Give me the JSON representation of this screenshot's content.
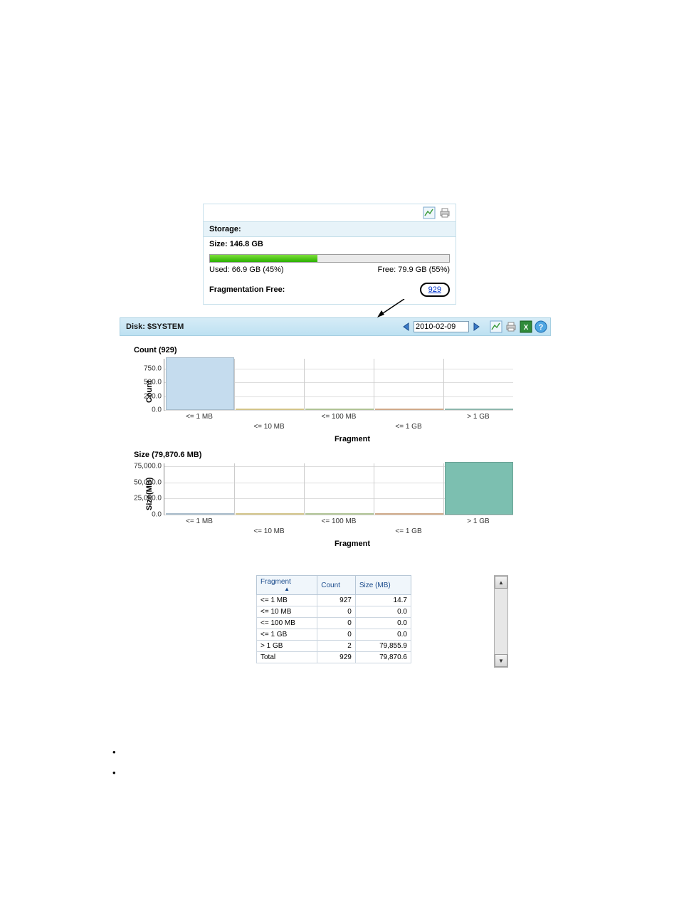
{
  "storage": {
    "header_label": "Storage:",
    "size_label": "Size: 146.8 GB",
    "used_label": "Used: 66.9 GB (45%)",
    "free_label": "Free: 79.9 GB (55%)",
    "used_pct": 45,
    "frag_label": "Fragmentation Free:",
    "frag_value": "929"
  },
  "toolbar": {
    "disk_label": "Disk: $SYSTEM",
    "date": "2010-02-09"
  },
  "chart_data": [
    {
      "type": "bar",
      "title": "Count (929)",
      "ylabel": "Count",
      "xlabel": "Fragment",
      "ylim": [
        0,
        927
      ],
      "yticks": [
        "0.0",
        "250.0",
        "500.0",
        "750.0"
      ],
      "categories": [
        "<= 1 MB",
        "<= 10 MB",
        "<= 100 MB",
        "<= 1 GB",
        "> 1 GB"
      ],
      "values": [
        927,
        0,
        0,
        0,
        2
      ],
      "colors": [
        "#c5dcee",
        "#f7e7a1",
        "#cfe6b0",
        "#f4c7a1",
        "#a6d6cc"
      ]
    },
    {
      "type": "bar",
      "title": "Size (79,870.6 MB)",
      "ylabel": "Size(MB)",
      "xlabel": "Fragment",
      "ylim": [
        0,
        79856
      ],
      "yticks": [
        "0.0",
        "25,000.0",
        "50,000.0",
        "75,000.0"
      ],
      "categories": [
        "<= 1 MB",
        "<= 10 MB",
        "<= 100 MB",
        "<= 1 GB",
        "> 1 GB"
      ],
      "values": [
        14.7,
        0,
        0,
        0,
        79855.9
      ],
      "colors": [
        "#c5dcee",
        "#f7e7a1",
        "#cfe6b0",
        "#f4c7a1",
        "#7cbfb0"
      ]
    }
  ],
  "table": {
    "headers": [
      "Fragment",
      "Count",
      "Size (MB)"
    ],
    "rows": [
      [
        "<= 1 MB",
        "927",
        "14.7"
      ],
      [
        "<= 10 MB",
        "0",
        "0.0"
      ],
      [
        "<= 100 MB",
        "0",
        "0.0"
      ],
      [
        "<= 1 GB",
        "0",
        "0.0"
      ],
      [
        "> 1 GB",
        "2",
        "79,855.9"
      ],
      [
        "Total",
        "929",
        "79,870.6"
      ]
    ]
  }
}
